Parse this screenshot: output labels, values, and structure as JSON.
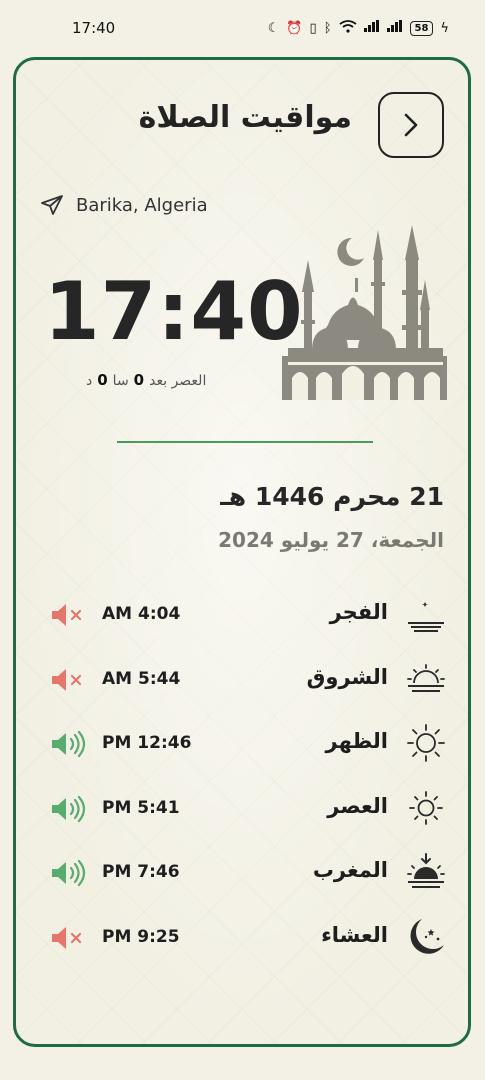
{
  "status_bar": {
    "time": "17:40",
    "battery": "58"
  },
  "header": {
    "title": "مواقيت الصلاة"
  },
  "location": {
    "text": "Barika, Algeria"
  },
  "clock": {
    "time": "17:40",
    "countdown_label": "العصر بعد",
    "countdown_hours": "0",
    "countdown_hours_unit": "سا",
    "countdown_minutes": "0",
    "countdown_minutes_unit": "د"
  },
  "dates": {
    "hijri": "21 محرم 1446 هـ",
    "gregorian": "الجمعة، 27 يوليو 2024"
  },
  "colors": {
    "accent": "#1e6b45",
    "sound_on": "#5aab6e",
    "sound_off": "#e4766b"
  },
  "prayers": [
    {
      "name": "الفجر",
      "time": "AM 4:04",
      "icon": "fajr-moon-icon",
      "sound": "off"
    },
    {
      "name": "الشروق",
      "time": "AM 5:44",
      "icon": "sunrise-icon",
      "sound": "off"
    },
    {
      "name": "الظهر",
      "time": "PM 12:46",
      "icon": "sun-icon",
      "sound": "on"
    },
    {
      "name": "العصر",
      "time": "PM 5:41",
      "icon": "sun-small-icon",
      "sound": "on"
    },
    {
      "name": "المغرب",
      "time": "PM 7:46",
      "icon": "sunset-icon",
      "sound": "on"
    },
    {
      "name": "العشاء",
      "time": "PM 9:25",
      "icon": "crescent-stars-icon",
      "sound": "off"
    }
  ]
}
